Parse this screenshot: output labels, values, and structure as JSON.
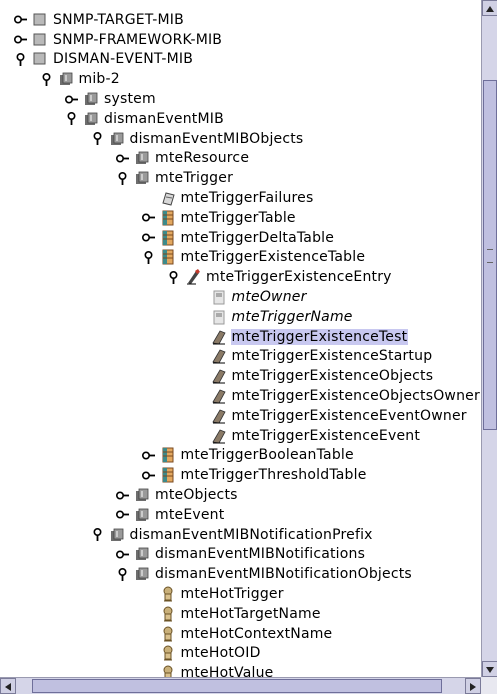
{
  "tree": {
    "rows": [
      {
        "label": "SNMP-TARGET-MIB",
        "depth": 0,
        "toggle": "collapsed",
        "icon": "module"
      },
      {
        "label": "SNMP-FRAMEWORK-MIB",
        "depth": 0,
        "toggle": "collapsed",
        "icon": "module"
      },
      {
        "label": "DISMAN-EVENT-MIB",
        "depth": 0,
        "toggle": "expanded",
        "icon": "module"
      },
      {
        "label": "mib-2",
        "depth": 1,
        "toggle": "expanded",
        "icon": "folder"
      },
      {
        "label": "system",
        "depth": 2,
        "toggle": "collapsed",
        "icon": "folder"
      },
      {
        "label": "dismanEventMIB",
        "depth": 2,
        "toggle": "expanded",
        "icon": "folder"
      },
      {
        "label": "dismanEventMIBObjects",
        "depth": 3,
        "toggle": "expanded",
        "icon": "folder"
      },
      {
        "label": "mteResource",
        "depth": 4,
        "toggle": "collapsed",
        "icon": "folder"
      },
      {
        "label": "mteTrigger",
        "depth": 4,
        "toggle": "expanded",
        "icon": "folder"
      },
      {
        "label": "mteTriggerFailures",
        "depth": 5,
        "toggle": "none",
        "icon": "scalar"
      },
      {
        "label": "mteTriggerTable",
        "depth": 5,
        "toggle": "collapsed",
        "icon": "table"
      },
      {
        "label": "mteTriggerDeltaTable",
        "depth": 5,
        "toggle": "collapsed",
        "icon": "table"
      },
      {
        "label": "mteTriggerExistenceTable",
        "depth": 5,
        "toggle": "expanded",
        "icon": "table"
      },
      {
        "label": "mteTriggerExistenceEntry",
        "depth": 6,
        "toggle": "expanded",
        "icon": "entry"
      },
      {
        "label": "mteOwner",
        "depth": 7,
        "toggle": "none",
        "icon": "index",
        "italic": true
      },
      {
        "label": "mteTriggerName",
        "depth": 7,
        "toggle": "none",
        "icon": "index",
        "italic": true
      },
      {
        "label": "mteTriggerExistenceTest",
        "depth": 7,
        "toggle": "none",
        "icon": "column",
        "selected": true
      },
      {
        "label": "mteTriggerExistenceStartup",
        "depth": 7,
        "toggle": "none",
        "icon": "column"
      },
      {
        "label": "mteTriggerExistenceObjects",
        "depth": 7,
        "toggle": "none",
        "icon": "column"
      },
      {
        "label": "mteTriggerExistenceObjectsOwner",
        "depth": 7,
        "toggle": "none",
        "icon": "column"
      },
      {
        "label": "mteTriggerExistenceEventOwner",
        "depth": 7,
        "toggle": "none",
        "icon": "column"
      },
      {
        "label": "mteTriggerExistenceEvent",
        "depth": 7,
        "toggle": "none",
        "icon": "column"
      },
      {
        "label": "mteTriggerBooleanTable",
        "depth": 5,
        "toggle": "collapsed",
        "icon": "table"
      },
      {
        "label": "mteTriggerThresholdTable",
        "depth": 5,
        "toggle": "collapsed",
        "icon": "table"
      },
      {
        "label": "mteObjects",
        "depth": 4,
        "toggle": "collapsed",
        "icon": "folder"
      },
      {
        "label": "mteEvent",
        "depth": 4,
        "toggle": "collapsed",
        "icon": "folder"
      },
      {
        "label": "dismanEventMIBNotificationPrefix",
        "depth": 3,
        "toggle": "expanded",
        "icon": "folder"
      },
      {
        "label": "dismanEventMIBNotifications",
        "depth": 4,
        "toggle": "collapsed",
        "icon": "folder"
      },
      {
        "label": "dismanEventMIBNotificationObjects",
        "depth": 4,
        "toggle": "expanded",
        "icon": "folder"
      },
      {
        "label": "mteHotTrigger",
        "depth": 5,
        "toggle": "none",
        "icon": "notif"
      },
      {
        "label": "mteHotTargetName",
        "depth": 5,
        "toggle": "none",
        "icon": "notif"
      },
      {
        "label": "mteHotContextName",
        "depth": 5,
        "toggle": "none",
        "icon": "notif"
      },
      {
        "label": "mteHotOID",
        "depth": 5,
        "toggle": "none",
        "icon": "notif"
      },
      {
        "label": "mteHotValue",
        "depth": 5,
        "toggle": "none",
        "icon": "notif"
      }
    ]
  },
  "colors": {
    "selection": "#c8c8f0",
    "scrollbar": "#d5d5e8",
    "scroll_thumb": "#c0c0e0"
  }
}
